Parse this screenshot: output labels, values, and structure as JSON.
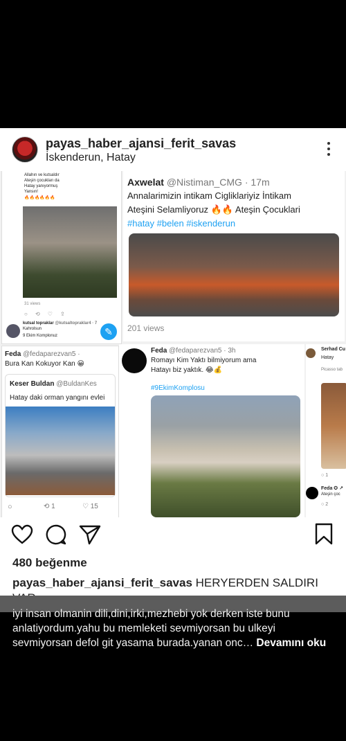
{
  "post": {
    "username": "payas_haber_ajansi_ferit_savas",
    "location": "İskenderun, Hatay",
    "likes": "480 beğenme",
    "caption_username": "payas_haber_ajansi_ferit_savas",
    "caption_text": "HERYERDEN SALDIRI VAR",
    "more_caption": "iyi insan olmanin dili,dini,irki,mezhebi yok derken iste bunu anlatiyordum.yahu bu memleketi sevmiyorsan bu ulkeyi sevmiyorsan defol git yasama burada.yanan onc…",
    "more_link": "Devamını oku"
  },
  "collage": {
    "top_left": {
      "lines": [
        "Allahın ve kutsaldır",
        "Ateşin çocukları da",
        "Hatay yanıyormuş",
        "Yansın!",
        "🔥🔥🔥🔥🔥🔥"
      ],
      "views": "31 views",
      "reposter_name": "kutsal topraklar",
      "reposter_handle": "@kutsaltopraklar4 · 7",
      "reposter_text1": "Kahrolsun",
      "reposter_text2": "9 Ekim Komplonuz"
    },
    "top_right": {
      "name": "Axwelat",
      "handle": "@Nistiman_CMG · 17m",
      "line1": "Annalarimizin intikam Cigliklariyiz İntikam",
      "line2": "Ateşini Selamliyoruz 🔥🔥 Ateşin Çocuklari",
      "hashtags": "#hatay #belen #iskenderun",
      "views": "201 views"
    },
    "bottom_left": {
      "name": "Feda",
      "handle": "@fedaparezvan5 ·",
      "text": "Bura Kan Kokuyor Kan 😀",
      "quote_name": "Keser Buldan",
      "quote_handle": "@BuldanKes",
      "quote_text": "Hatay daki orman yangını evlei",
      "retweets": "1",
      "likes": "15"
    },
    "bottom_middle": {
      "name": "Feda",
      "handle": "@fedaparezvan5 · 3h",
      "line1": "Romayı Kim Yaktı bilmiyorum ama",
      "line2": "Hatayı biz yaktık. 😂💰",
      "hashtag": "#9EkimKomplosu"
    },
    "bottom_right": {
      "name": "Serhad Cu",
      "place": "Hatay",
      "sub": "Picasso tab",
      "name2": "Feda",
      "sub2": "Ateşin çoc",
      "count1": "1",
      "count2": "2"
    }
  },
  "icons": [
    "heart-icon",
    "comment-icon",
    "share-icon",
    "bookmark-icon",
    "more-options-icon"
  ]
}
